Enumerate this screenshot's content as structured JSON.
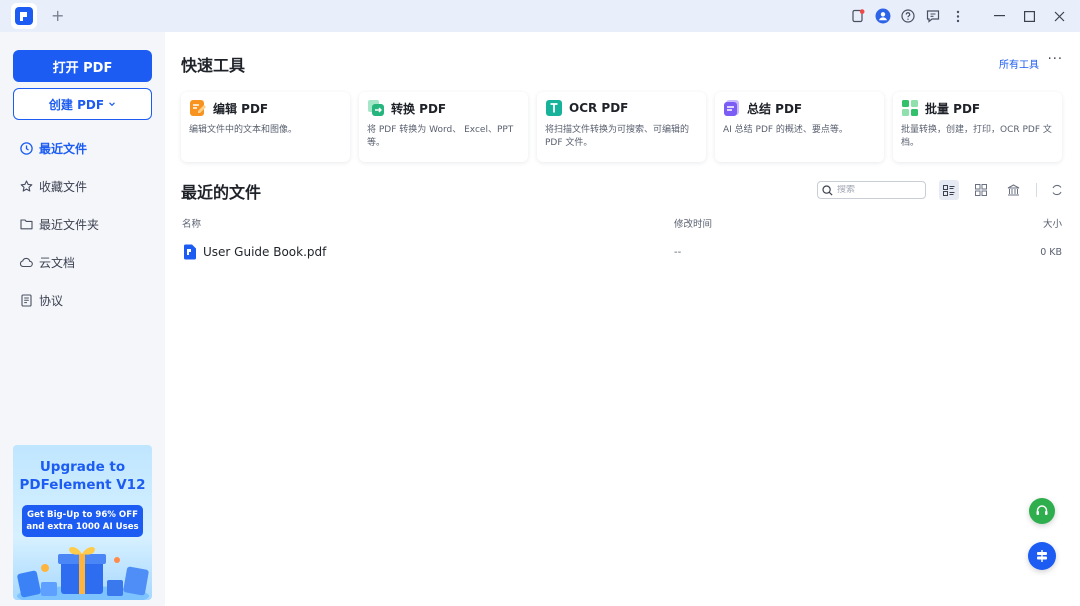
{
  "titlebar": {
    "new_tab": "+",
    "icons": [
      "notification-icon",
      "account-icon",
      "help-icon",
      "feedback-icon",
      "more-vertical-icon"
    ],
    "window_controls": [
      "minimize-icon",
      "maximize-icon",
      "close-icon"
    ]
  },
  "sidebar": {
    "open_pdf": "打开 PDF",
    "create_pdf": "创建 PDF",
    "items": [
      {
        "label": "最近文件",
        "icon": "clock-icon",
        "active": true
      },
      {
        "label": "收藏文件",
        "icon": "star-icon",
        "active": false
      },
      {
        "label": "最近文件夹",
        "icon": "folder-icon",
        "active": false
      },
      {
        "label": "云文档",
        "icon": "cloud-icon",
        "active": false
      },
      {
        "label": "协议",
        "icon": "document-icon",
        "active": false
      }
    ],
    "promo": {
      "line1": "Upgrade to",
      "line2": "PDFelement V12",
      "offer1": "Get Big-Up to 96% OFF",
      "offer2": "and extra 1000 AI Uses"
    }
  },
  "quick_tools": {
    "title": "快速工具",
    "all_tools": "所有工具",
    "more": "···",
    "cards": [
      {
        "title": "编辑 PDF",
        "desc": "编辑文件中的文本和图像。",
        "icon": "edit-pdf-icon",
        "color": "#f7931e"
      },
      {
        "title": "转换 PDF",
        "desc": "将 PDF 转换为 Word、 Excel、PPT等。",
        "icon": "convert-pdf-icon",
        "color": "#26b57d"
      },
      {
        "title": "OCR PDF",
        "desc": "将扫描文件转换为可搜索、可编辑的 PDF 文件。",
        "icon": "ocr-pdf-icon",
        "color": "#16b39a"
      },
      {
        "title": "总结 PDF",
        "desc": "AI 总结 PDF 的概述、要点等。",
        "icon": "summarize-pdf-icon",
        "color": "#7b5cf5"
      },
      {
        "title": "批量 PDF",
        "desc": "批量转换，创建，打印，OCR PDF 文档。",
        "icon": "batch-pdf-icon",
        "color": "#32c06a"
      }
    ]
  },
  "recent": {
    "title": "最近的文件",
    "search_placeholder": "搜索",
    "columns": {
      "name": "名称",
      "modified": "修改时间",
      "size": "大小"
    },
    "files": [
      {
        "name": "User Guide Book.pdf",
        "modified": "--",
        "size": "0 KB"
      }
    ]
  },
  "colors": {
    "accent": "#1c5cf2",
    "sidebar_bg": "#f4f6fa",
    "titlebar_bg": "#e9eefb"
  }
}
